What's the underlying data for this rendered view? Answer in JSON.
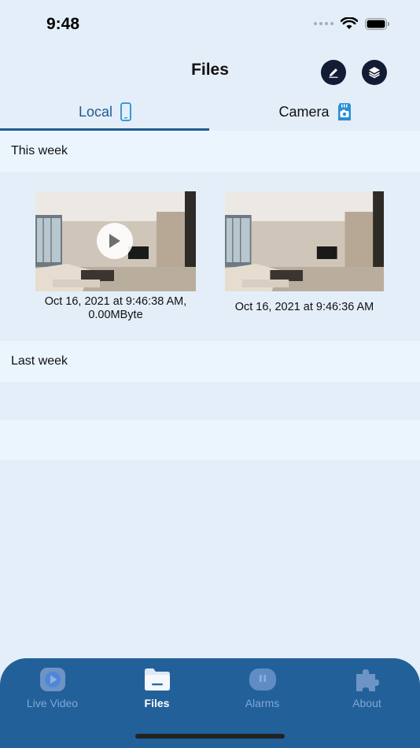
{
  "status_bar": {
    "time": "9:48"
  },
  "header": {
    "title": "Files"
  },
  "tabs": [
    {
      "label": "Local",
      "icon": "phone-icon",
      "active": true
    },
    {
      "label": "Camera",
      "icon": "sd-card-camera-icon",
      "active": false
    }
  ],
  "sections": [
    {
      "title": "This week",
      "items": [
        {
          "caption": "Oct 16, 2021 at 9:46:38 AM, 0.00MByte",
          "type": "video"
        },
        {
          "caption": "Oct 16, 2021 at 9:46:36 AM",
          "type": "photo"
        }
      ]
    },
    {
      "title": "Last week",
      "items": []
    }
  ],
  "tab_bar": {
    "items": [
      {
        "label": "Live Video",
        "icon": "play-icon",
        "active": false
      },
      {
        "label": "Files",
        "icon": "folder-icon",
        "active": true
      },
      {
        "label": "Alarms",
        "icon": "alarm-icon",
        "active": false
      },
      {
        "label": "About",
        "icon": "puzzle-icon",
        "active": false
      }
    ]
  },
  "colors": {
    "accent": "#1f5a94",
    "tab_bar": "#22609a",
    "section_bg": "#ebf5fe",
    "page_bg": "#e3eef8"
  }
}
